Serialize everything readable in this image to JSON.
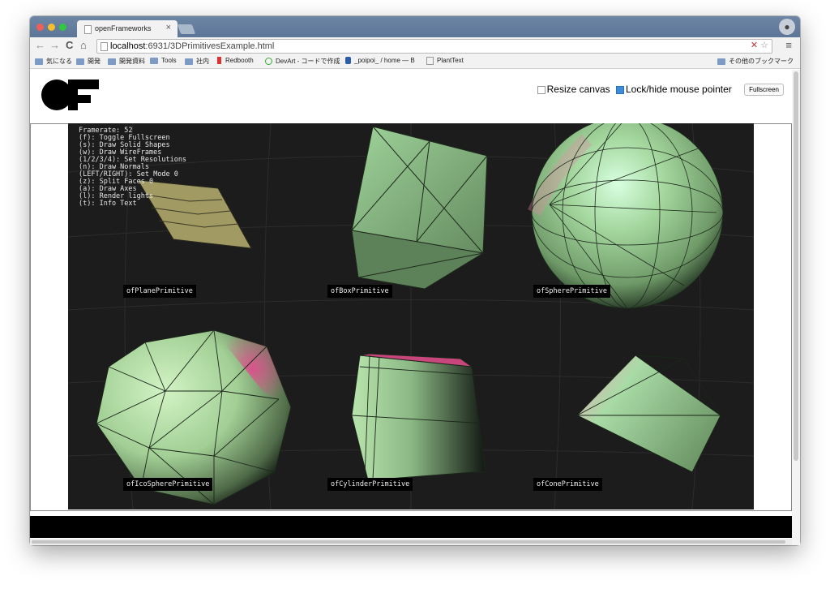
{
  "browser": {
    "tab_title": "openFrameworks",
    "tab_close": "×",
    "url_host": "localhost",
    "url_rest": ":6931/3DPrimitivesExample.html",
    "nav_back": "←",
    "nav_forward": "→",
    "nav_reload": "C",
    "nav_home": "⌂",
    "menu": "≡",
    "star": "☆"
  },
  "bookmarks": [
    {
      "label": "気になる",
      "icon": "folder-icon"
    },
    {
      "label": "開発",
      "icon": "folder-icon"
    },
    {
      "label": "開発資料",
      "icon": "folder-icon"
    },
    {
      "label": "Tools",
      "icon": "folder-icon"
    },
    {
      "label": "社内",
      "icon": "folder-icon"
    },
    {
      "label": "Redbooth",
      "icon": "redbooth-icon"
    },
    {
      "label": "DevArt - コードで作成",
      "icon": "devart-icon"
    },
    {
      "label": "_poipoi_ / home — B",
      "icon": "bitbucket-icon"
    },
    {
      "label": "PlantText",
      "icon": "page-icon"
    }
  ],
  "bookmarks_other": "その他のブックマーク",
  "page": {
    "logo_text": "OF",
    "resize_label": "Resize canvas",
    "resize_checked": false,
    "lock_label": "Lock/hide mouse pointer",
    "lock_checked": true,
    "fullscreen_label": "Fullscreen"
  },
  "info_text": "Framerate: 52\n(f): Toggle Fullscreen\n(s): Draw Solid Shapes\n(w): Draw WireFrames\n(1/2/3/4): Set Resolutions\n(n): Draw Normals\n(LEFT/RIGHT): Set Mode 0\n(z): Split Faces 0\n(a): Draw Axes\n(l): Render lights\n(t): Info Text",
  "primitives": [
    "ofPlanePrimitive",
    "ofBoxPrimitive",
    "ofSpherePrimitive",
    "ofIcoSpherePrimitive",
    "ofCylinderPrimitive",
    "ofConePrimitive"
  ],
  "colors": {
    "chrome_blue": "#5d7596",
    "shape_green": "#a9d8a4",
    "shape_pink": "#e38aa6",
    "plane_olive": "#a29a63",
    "canvas_bg": "#1c1c1c"
  }
}
